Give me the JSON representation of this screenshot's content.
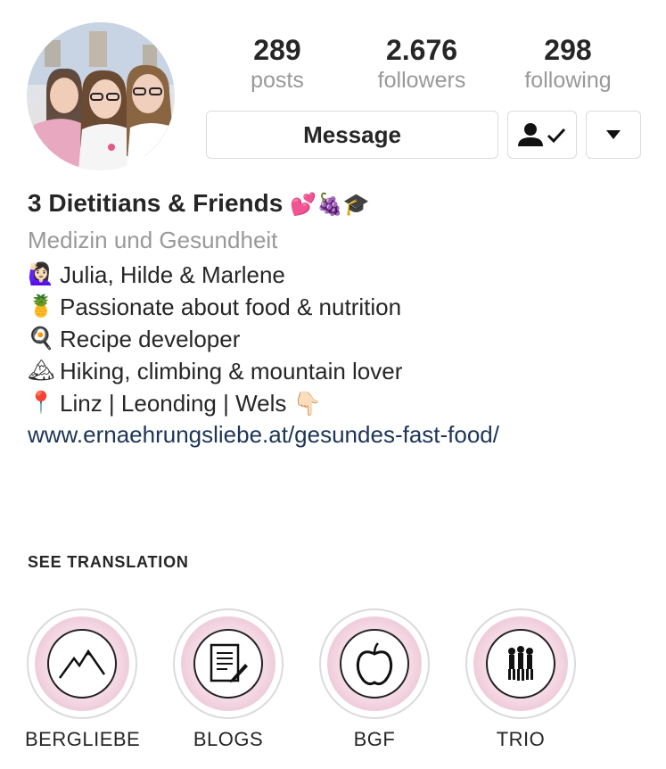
{
  "profile": {
    "stats": {
      "posts": {
        "value": "289",
        "label": "posts"
      },
      "followers": {
        "value": "2.676",
        "label": "followers"
      },
      "following": {
        "value": "298",
        "label": "following"
      }
    },
    "buttons": {
      "message": "Message"
    },
    "name": "3 Dietitians & Friends",
    "name_emojis": "💕🍇🎓",
    "category": "Medizin und Gesundheit",
    "bio": [
      {
        "emoji": "🙋🏻‍♀️",
        "text": "Julia, Hilde & Marlene"
      },
      {
        "emoji": "🍍",
        "text": "Passionate about food & nutrition"
      },
      {
        "emoji": "🍳",
        "text": "Recipe developer"
      },
      {
        "emoji": "🏔",
        "text": "Hiking, climbing & mountain lover"
      },
      {
        "emoji": "📍",
        "text": "Linz | Leonding | Wels 👇🏻"
      }
    ],
    "url": "www.ernaehrungsliebe.at/gesundes-fast-food/",
    "see_translation": "SEE TRANSLATION"
  },
  "highlights": [
    {
      "name": "BERGLIEBE",
      "icon": "mountain-icon"
    },
    {
      "name": "BLOGS",
      "icon": "document-pen-icon"
    },
    {
      "name": "BGF",
      "icon": "apple-icon"
    },
    {
      "name": "TRIO",
      "icon": "three-people-icon"
    }
  ],
  "colors": {
    "text": "#262626",
    "muted": "#999999",
    "link": "#1d3557",
    "border": "#dbdbdb",
    "highlight_pink": "#e6b3c8"
  }
}
